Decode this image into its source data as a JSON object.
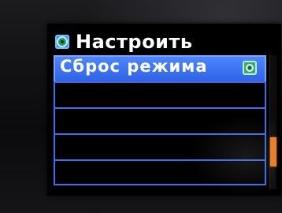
{
  "header": {
    "title": "Настроить",
    "icon": "gear-icon"
  },
  "menu": {
    "items": [
      {
        "label": "Сброс режима",
        "selected": true,
        "icon": "reset-icon"
      },
      {
        "label": "",
        "selected": false
      },
      {
        "label": "",
        "selected": false
      },
      {
        "label": "",
        "selected": false
      },
      {
        "label": "",
        "selected": false
      }
    ]
  },
  "scroll": {
    "position_fraction": 0.78,
    "visible_fraction": 0.22,
    "color": "#f07f1f"
  },
  "colors": {
    "accent": "#3b6ff0",
    "selected_bg": "#2f63e6",
    "text": "#ffffff"
  }
}
